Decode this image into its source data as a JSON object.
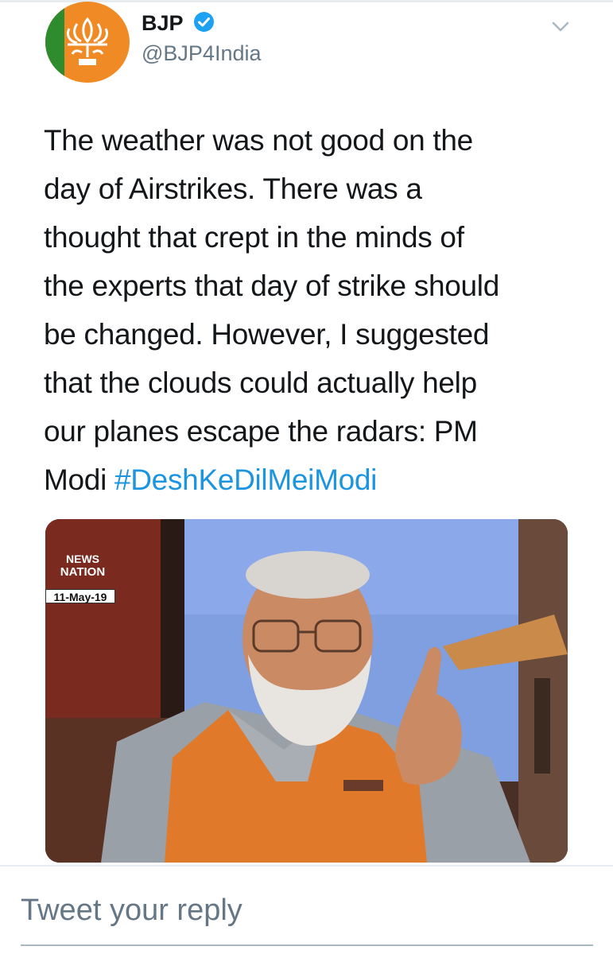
{
  "tweet": {
    "author_name": "BJP",
    "handle": "@BJP4India",
    "text_lines": [
      "The weather was not good on the",
      "day of Airstrikes. There was a",
      "thought that crept in the minds of",
      "the experts that day of strike should",
      "be changed. However, I suggested",
      "that the clouds could actually help",
      "our planes escape the radars: PM",
      "Modi "
    ],
    "hashtag": "#DeshKeDilMeiModi"
  },
  "media": {
    "channel_logo_line1": "NEWS",
    "channel_logo_line2": "NATION",
    "date": "11-May-19"
  },
  "reply": {
    "placeholder": "Tweet your reply"
  },
  "icons": {
    "verified": "verified-badge-icon",
    "menu": "chevron-down-icon"
  },
  "colors": {
    "link": "#1b95e0",
    "secondary_text": "#657786",
    "verified": "#1da1f2"
  }
}
